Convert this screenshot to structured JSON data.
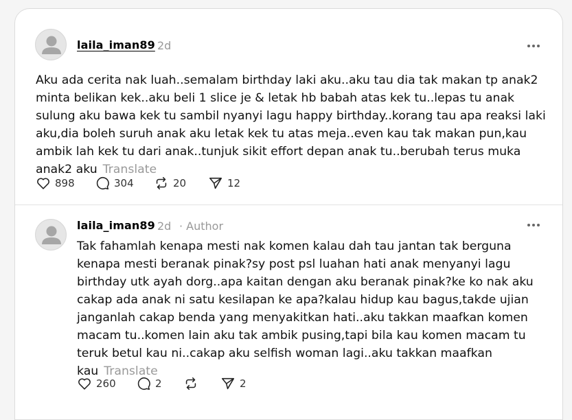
{
  "posts": [
    {
      "username": "laila_iman89",
      "time": "2d",
      "body": "Aku ada cerita nak luah..semalam birthday laki aku..aku tau dia tak makan tp anak2 minta belikan kek..aku beli 1 slice je & letak hb babah atas kek tu..lepas tu anak sulung aku bawa kek tu sambil nyanyi lagu happy birthday..korang tau apa reaksi laki aku,dia boleh suruh anak aku letak kek tu atas meja..even kau tak makan pun,kau ambik lah kek tu dari anak..tunjuk sikit effort depan anak tu..berubah terus muka anak2 aku",
      "translate": "Translate",
      "likes": "898",
      "replies": "304",
      "reposts": "20",
      "shares": "12"
    },
    {
      "username": "laila_iman89",
      "time": "2d",
      "author_tag": "· Author",
      "body": "Tak fahamlah kenapa mesti nak komen kalau dah tau jantan tak berguna kenapa mesti beranak pinak?sy post psl luahan hati anak menyanyi lagu birthday utk ayah dorg..apa kaitan dengan aku beranak pinak?ke ko nak aku cakap ada anak ni satu kesilapan ke apa?kalau hidup kau bagus,takde ujian janganlah cakap benda yang menyakitkan hati..aku takkan maafkan komen macam tu..komen lain aku tak ambik pusing,tapi bila kau komen macam tu teruk betul kau ni..cakap aku selfish woman lagi..aku takkan maafkan kau",
      "translate": "Translate",
      "likes": "260",
      "replies": "2",
      "reposts": "",
      "shares": "2"
    }
  ],
  "icons": {
    "avatar": "default-avatar-icon",
    "more": "more-options-icon",
    "like": "heart-icon",
    "reply": "comment-icon",
    "repost": "repost-icon",
    "share": "send-icon"
  }
}
